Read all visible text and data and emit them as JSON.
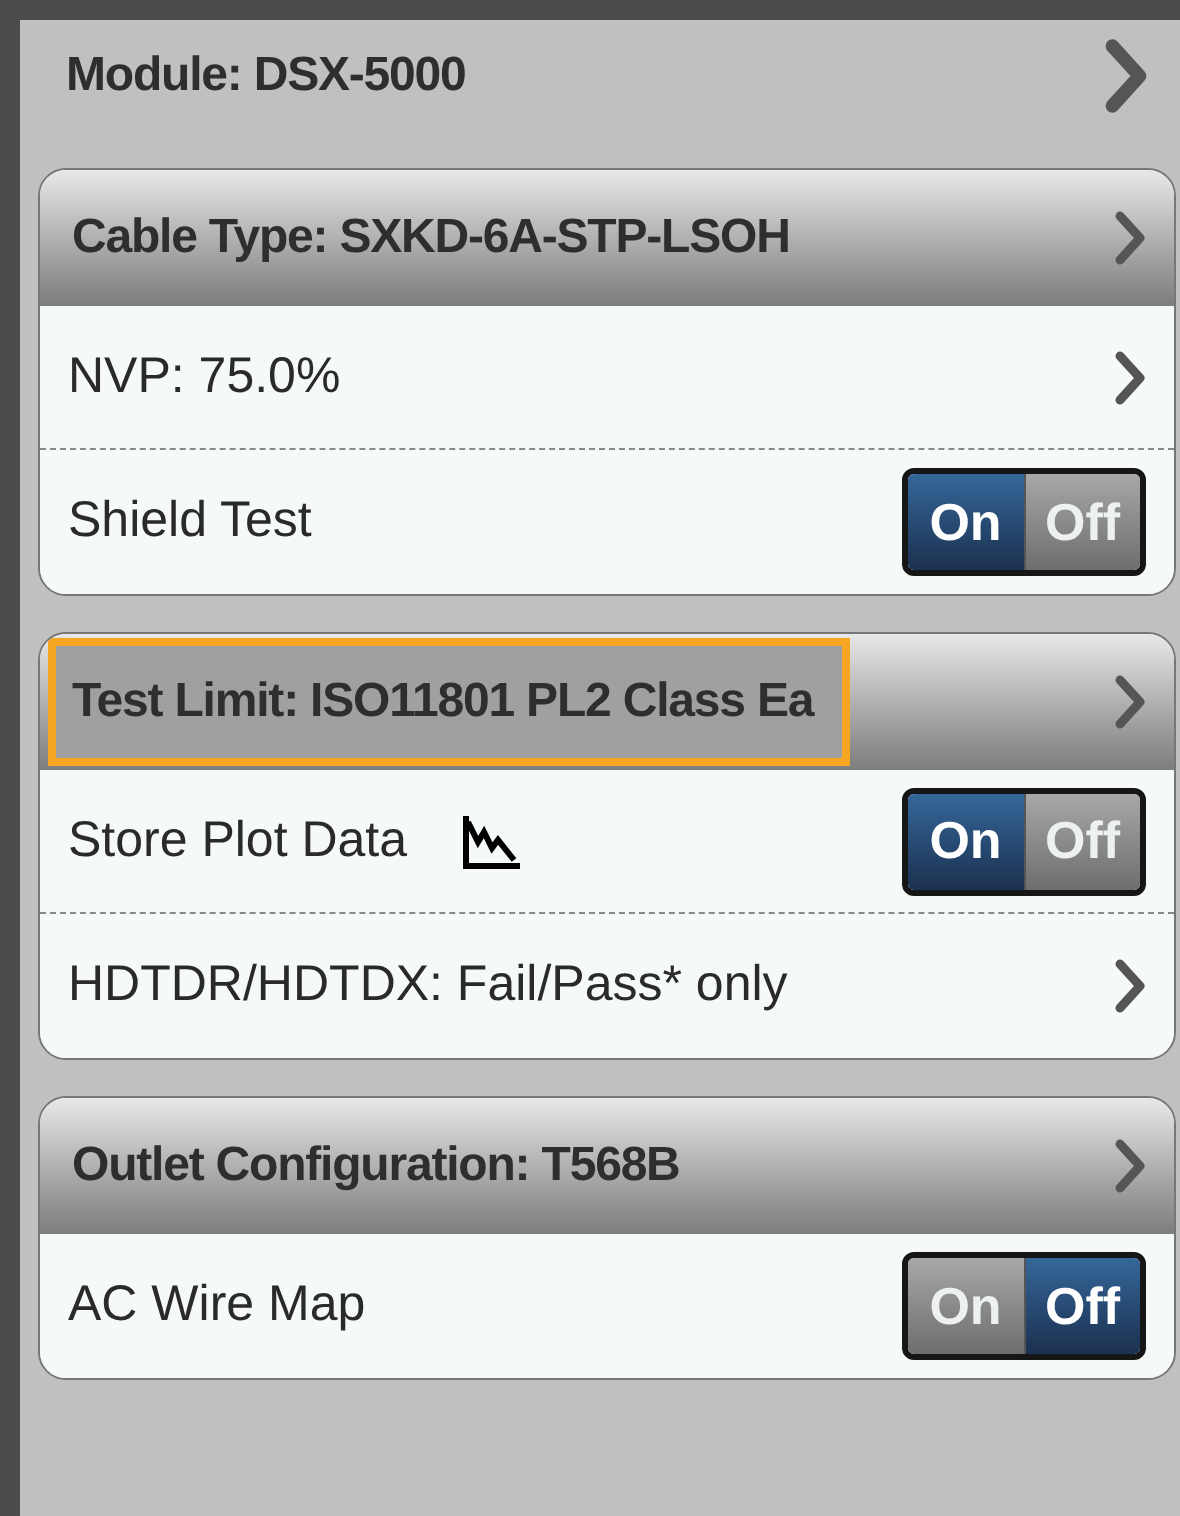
{
  "module": {
    "label": "Module: DSX-5000"
  },
  "groups": [
    {
      "header": {
        "label": "Cable Type: SXKD-6A-STP-LSOH",
        "focused": false
      },
      "rows": [
        {
          "kind": "link",
          "label": "NVP: 75.0%"
        },
        {
          "kind": "toggle",
          "label": "Shield Test",
          "plot_icon": false,
          "on": true,
          "on_label": "On",
          "off_label": "Off"
        }
      ]
    },
    {
      "header": {
        "label": "Test Limit: ISO11801 PL2 Class Ea",
        "focused": true
      },
      "rows": [
        {
          "kind": "toggle",
          "label": "Store Plot Data",
          "plot_icon": true,
          "on": true,
          "on_label": "On",
          "off_label": "Off"
        },
        {
          "kind": "link",
          "label": "HDTDR/HDTDX: Fail/Pass* only"
        }
      ]
    },
    {
      "header": {
        "label": "Outlet Configuration: T568B",
        "focused": false
      },
      "rows": [
        {
          "kind": "toggle",
          "label": "AC Wire Map",
          "plot_icon": false,
          "on": false,
          "on_label": "On",
          "off_label": "Off"
        }
      ]
    }
  ]
}
